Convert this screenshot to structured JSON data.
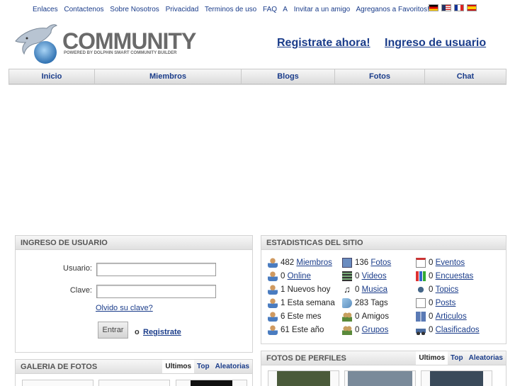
{
  "topnav": {
    "links": [
      "Enlaces",
      "Contactenos",
      "Sobre Nosotros",
      "Privacidad",
      "Terminos de uso",
      "FAQ",
      "A",
      "Invitar a un amigo",
      "Agreganos a Favoritos!"
    ]
  },
  "header": {
    "brand": "COMMUNITY",
    "tagline": "POWERED BY DOLPHIN SMART COMMUNITY BUILDER",
    "register_link": "Registrate ahora!",
    "login_link": "Ingreso de usuario"
  },
  "nav": {
    "items": [
      "Inicio",
      "Miembros",
      "Blogs",
      "Fotos",
      "Chat"
    ]
  },
  "login": {
    "title": "INGRESO DE USUARIO",
    "username_label": "Usuario:",
    "username_value": "",
    "password_label": "Clave:",
    "password_value": "",
    "forgot_link": "Olvido su clave?",
    "submit_label": "Entrar",
    "or_text": "o",
    "register_link": "Registrate"
  },
  "stats": {
    "title": "ESTADISTICAS DEL SITIO",
    "col1": [
      {
        "count": "482",
        "label": "Miembros",
        "link": true,
        "icon": "user-icon"
      },
      {
        "count": "0",
        "label": "Online",
        "link": true,
        "icon": "user-icon"
      },
      {
        "count": "1",
        "label": "Nuevos hoy",
        "link": false,
        "icon": "user-icon"
      },
      {
        "count": "1",
        "label": "Esta semana",
        "link": false,
        "icon": "user-icon"
      },
      {
        "count": "6",
        "label": "Este mes",
        "link": false,
        "icon": "user-icon"
      },
      {
        "count": "61",
        "label": "Este año",
        "link": false,
        "icon": "user-icon"
      }
    ],
    "col2": [
      {
        "count": "136",
        "label": "Fotos",
        "link": true,
        "icon": "photo-icon"
      },
      {
        "count": "0",
        "label": "Videos",
        "link": true,
        "icon": "film-icon"
      },
      {
        "count": "0",
        "label": "Musica",
        "link": true,
        "icon": "music-icon"
      },
      {
        "count": "283",
        "label": "Tags",
        "link": false,
        "icon": "tag-icon"
      },
      {
        "count": "0",
        "label": "Amigos",
        "link": false,
        "icon": "friends-icon"
      },
      {
        "count": "0",
        "label": "Grupos",
        "link": true,
        "icon": "group-icon"
      }
    ],
    "col3": [
      {
        "count": "0",
        "label": "Eventos",
        "link": true,
        "icon": "calendar-icon"
      },
      {
        "count": "0",
        "label": "Encuestas",
        "link": true,
        "icon": "poll-icon"
      },
      {
        "count": "0",
        "label": " Topics",
        "link": true,
        "icon": "forum-icon"
      },
      {
        "count": "0",
        "label": "Posts",
        "link": true,
        "icon": "post-icon"
      },
      {
        "count": "0",
        "label": "Articulos",
        "link": true,
        "icon": "book-icon"
      },
      {
        "count": "0",
        "label": "Clasificados",
        "link": true,
        "icon": "car-icon"
      }
    ]
  },
  "gallery": {
    "title": "GALERIA DE FOTOS",
    "tabs": [
      "Ultimos",
      "Top",
      "Aleatorias"
    ]
  },
  "profiles": {
    "title": "FOTOS DE PERFILES",
    "tabs": [
      "Ultimos",
      "Top",
      "Aleatorias"
    ]
  }
}
